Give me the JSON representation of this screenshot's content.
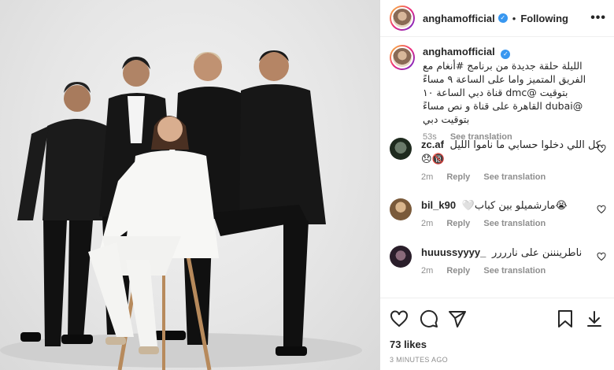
{
  "post": {
    "username": "anghamofficial",
    "dot": "•",
    "follow_label": "Following",
    "more_label": "•••"
  },
  "caption": {
    "username": "anghamofficial",
    "text": "الليلة حلقة جديدة من برنامج #أنغام مع الفريق المتميز واما على الساعة ٩ مساءً بتوقيت @dmc قناة دبي الساعة ١٠ @dubai القاهرة على قناة و نص مساءً بتوقيت دبي",
    "age": "53s",
    "see_translation": "See translation"
  },
  "comments": [
    {
      "username": "zc.af",
      "text": "كل اللي دخلوا حسابي ما ناموا الليل.😞🔞",
      "age": "2m",
      "reply": "Reply",
      "see_translation": "See translation"
    },
    {
      "username": "bil_k90",
      "text": "🤍مارشميلو بين كباب😭",
      "age": "2m",
      "reply": "Reply",
      "see_translation": "See translation"
    },
    {
      "username": "huuussyyyy_",
      "text": "ناطرينننن على نارررر",
      "age": "2m",
      "reply": "Reply",
      "see_translation": "See translation"
    }
  ],
  "likes": "73 likes",
  "timestamp": "3 MINUTES AGO",
  "icons": {
    "like": "heart-icon",
    "comment": "comment-icon",
    "share": "share-icon",
    "save": "bookmark-icon",
    "verified": "verified-badge-icon"
  },
  "colors": {
    "verified": "#3897f0",
    "secondary_text": "#8e8e8e",
    "link": "#00376b"
  }
}
